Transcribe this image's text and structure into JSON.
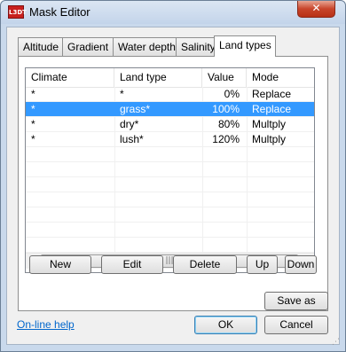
{
  "window": {
    "title": "Mask Editor",
    "app_icon_text": "L3DT",
    "close_glyph": "✕"
  },
  "tabs": [
    {
      "label": "Altitude"
    },
    {
      "label": "Gradient"
    },
    {
      "label": "Water depth"
    },
    {
      "label": "Salinity"
    },
    {
      "label": "Land types",
      "active": true
    }
  ],
  "list": {
    "columns": [
      "Climate",
      "Land type",
      "Value",
      "Mode"
    ],
    "rows": [
      {
        "climate": "*",
        "land_type": "*",
        "value": "0%",
        "mode": "Replace",
        "selected": false
      },
      {
        "climate": "*",
        "land_type": "grass*",
        "value": "100%",
        "mode": "Replace",
        "selected": true
      },
      {
        "climate": "*",
        "land_type": "dry*",
        "value": "80%",
        "mode": "Multply",
        "selected": false
      },
      {
        "climate": "*",
        "land_type": "lush*",
        "value": "120%",
        "mode": "Multply",
        "selected": false
      }
    ],
    "scroll_left_glyph": "◀",
    "scroll_right_glyph": "▶",
    "scroll_thumb_glyph": "|||"
  },
  "buttons": {
    "new": "New",
    "edit": "Edit",
    "delete": "Delete",
    "up": "Up",
    "down": "Down",
    "save_as": "Save as",
    "ok": "OK",
    "cancel": "Cancel"
  },
  "help_link": "On-line help",
  "colors": {
    "selection": "#3399ff",
    "link": "#0066cc",
    "title_bar": "#c9d9ec"
  }
}
